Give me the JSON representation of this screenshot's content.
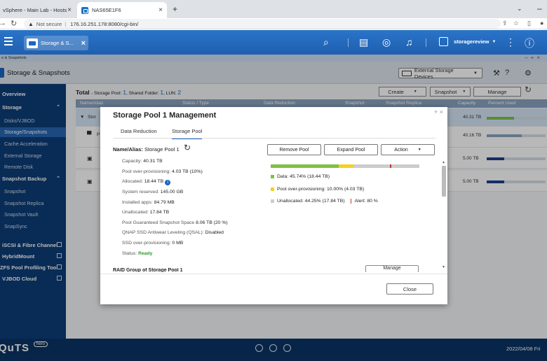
{
  "browser": {
    "tabs": [
      {
        "label": "vSphere - Main Lab - Hosts"
      },
      {
        "label": "NAS65E1F6"
      }
    ],
    "security": "Not secure",
    "url": "176.16.251.178:8080/cgi-bin/"
  },
  "qts": {
    "app_tab": "Storage & S...",
    "username": "storagereview"
  },
  "app": {
    "window_label": "e & Snapshots",
    "title": "Storage & Snapshots",
    "external_storage_label": "External Storage Devices"
  },
  "sidebar": {
    "overview": "Overview",
    "storage": "Storage",
    "storage_items": [
      "Disks/VJBOD",
      "Storage/Snapshots",
      "Cache Acceleration",
      "External Storage",
      "Remote Disk"
    ],
    "snapshot_backup": "Snapshot Backup",
    "backup_items": [
      "Snapshot",
      "Snapshot Replica",
      "Snapshot Vault",
      "SnapSync"
    ],
    "links": [
      "iSCSI & Fibre Channel",
      "HybridMount",
      "ZFS Pool Profiling Tool",
      "VJBOD Cloud"
    ]
  },
  "main": {
    "total_label": "Total",
    "total_pre": "- Storage Pool: ",
    "pool_count": "1",
    "shared_pre": ", Shared Folder: ",
    "shared_count": "1",
    "lun_pre": ", LUN: ",
    "lun_count": "2",
    "buttons": {
      "create": "Create",
      "snapshot": "Snapshot",
      "manage": "Manage"
    },
    "columns": [
      "Name/Alias",
      "Status / Type",
      "Data Reduction",
      "Snapshot",
      "Snapshot Replica",
      "Capacity",
      "Percent Used"
    ],
    "row1_name": "Stor",
    "row2_name": "P",
    "rows_capacity": [
      "40.31 TB",
      "40.16 TB",
      "5.00 TB",
      "5.00 TB"
    ]
  },
  "modal": {
    "title": "Storage Pool 1 Management",
    "tabs": [
      "Data Reduction",
      "Storage Pool"
    ],
    "name_label": "Name/Alias:",
    "name_value": "Storage Pool 1",
    "buttons": {
      "remove": "Remove Pool",
      "expand": "Expand Pool",
      "action": "Action"
    },
    "props": [
      {
        "label": "Capacity:",
        "value": "40.31 TB"
      },
      {
        "label": "Pool over-provisioning:",
        "value": "4.03 TB (10%)"
      },
      {
        "label": "Allocated:",
        "value": "18.44 TB"
      },
      {
        "label": "System reserved:",
        "value": "145.00 GB"
      },
      {
        "label": "Installed apps:",
        "value": "84.79 MB"
      },
      {
        "label": "Unallocated:",
        "value": "17.84 TB"
      },
      {
        "label": "Pool Guaranteed Snapshot Space",
        "value": "8.06 TB (20 %)"
      },
      {
        "label": "QNAP SSD Antiwear Leveling (QSAL):",
        "value": "Disabled"
      },
      {
        "label": "SSD over-provisioning:",
        "value": "0 MB"
      },
      {
        "label": "Status:",
        "value": "Ready"
      }
    ],
    "usage": {
      "data_percent": 45.74,
      "overprov_percent": 10.0,
      "unalloc_percent": 44.25,
      "alert_percent": 80,
      "colors": {
        "data": "#7dc242",
        "overprov": "#f5d020",
        "unalloc": "#cccccc",
        "alert": "#c0392b"
      }
    },
    "legend": {
      "data": "Data: 45.74% (18.44 TB)",
      "overprov": "Pool over-provisioning: 10.00% (4.03 TB)",
      "unalloc": "Unallocated: 44.25% (17.84 TB)",
      "alert": "Alert: 80 %"
    },
    "raid_label": "RAID Group of Storage Pool 1",
    "manage_label": "Manage",
    "close_label": "Close"
  },
  "footer": {
    "brand": "QuTS",
    "hero": "hero",
    "date": "2022/04/08 Fri"
  }
}
